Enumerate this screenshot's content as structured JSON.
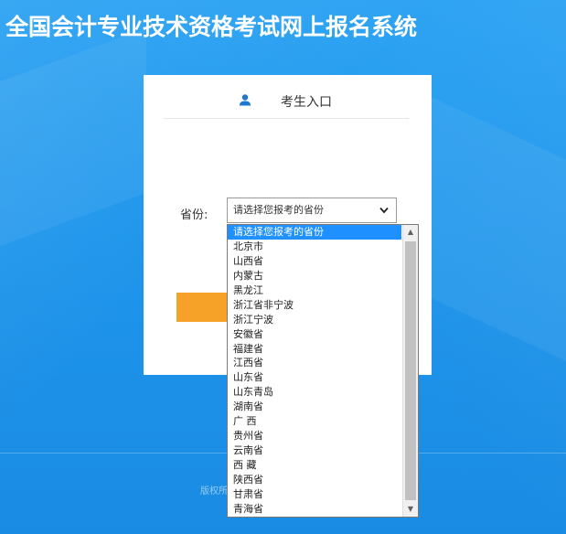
{
  "page": {
    "title": "全国会计专业技术资格考试网上报名系统"
  },
  "login": {
    "header": "考生入口",
    "province_label": "省份:",
    "select_value": "请选择您报考的省份"
  },
  "footer": {
    "copyright_fragment": "版权所"
  },
  "dropdown": {
    "options": [
      "请选择您报考的省份",
      "北京市",
      "山西省",
      "内蒙古",
      "黑龙江",
      "浙江省非宁波",
      "浙江宁波",
      "安徽省",
      "福建省",
      "江西省",
      "山东省",
      "山东青岛",
      "湖南省",
      "广 西",
      "贵州省",
      "云南省",
      "西 藏",
      "陕西省",
      "甘肃省",
      "青海省"
    ],
    "selected_index": 0
  },
  "colors": {
    "background": "#1b8ee6",
    "accent_button": "#f6a229",
    "selected_option": "#1e90ff",
    "user_icon": "#1e78d2"
  }
}
